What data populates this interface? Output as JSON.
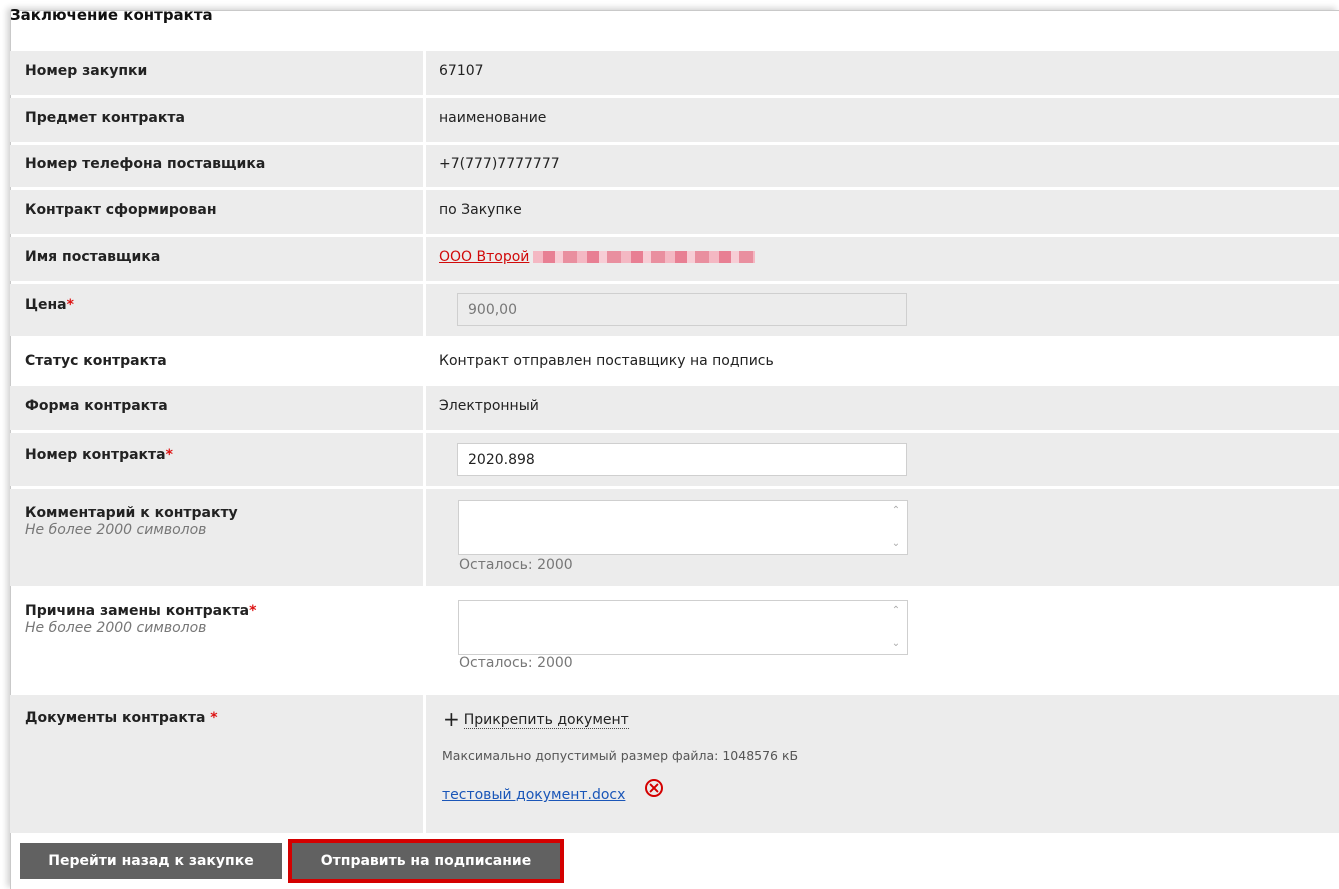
{
  "page": {
    "title": "Заключение контракта"
  },
  "fields": {
    "purchase_number": {
      "label": "Номер закупки",
      "value": "67107"
    },
    "subject": {
      "label": "Предмет контракта",
      "value": "наименование"
    },
    "supplier_phone": {
      "label": "Номер телефона поставщика",
      "value": "+7(777)7777777"
    },
    "formed_by": {
      "label": "Контракт сформирован",
      "value": "по Закупке"
    },
    "supplier_name": {
      "label": "Имя поставщика",
      "value": "ООО Второй"
    },
    "price": {
      "label": "Цена",
      "required_mark": "*",
      "value": "900,00"
    },
    "status": {
      "label": "Статус контракта",
      "value": "Контракт отправлен поставщику на подпись"
    },
    "form": {
      "label": "Форма контракта",
      "value": "Электронный"
    },
    "contract_number": {
      "label": "Номер контракта",
      "required_mark": "*",
      "value": "2020.898"
    },
    "comment": {
      "label": "Комментарий к контракту",
      "hint": "Не более 2000 символов",
      "value": "",
      "remaining": "Осталось: 2000"
    },
    "replace_reason": {
      "label": "Причина замены контракта",
      "required_mark": "*",
      "hint": "Не более 2000 символов",
      "value": "",
      "remaining": "Осталось: 2000"
    },
    "documents": {
      "label": "Документы контракта ",
      "required_mark": "*",
      "attach_label": "Прикрепить документ",
      "max_size": "Максимально допустимый размер файла: 1048576 кБ",
      "files": [
        {
          "name": "тестовый документ.docx"
        }
      ]
    }
  },
  "buttons": {
    "back": "Перейти назад к закупке",
    "send": "Отправить на подписание"
  },
  "colors": {
    "accent_red": "#d40000",
    "link_blue": "#1a56b8",
    "button_gray": "#616161",
    "row_gray": "#ececec"
  },
  "icons": {
    "attach": "plus-icon",
    "remove": "remove-circle-x-icon",
    "textarea_scroll_up": "chevron-up-icon",
    "textarea_scroll_down": "chevron-down-icon"
  }
}
